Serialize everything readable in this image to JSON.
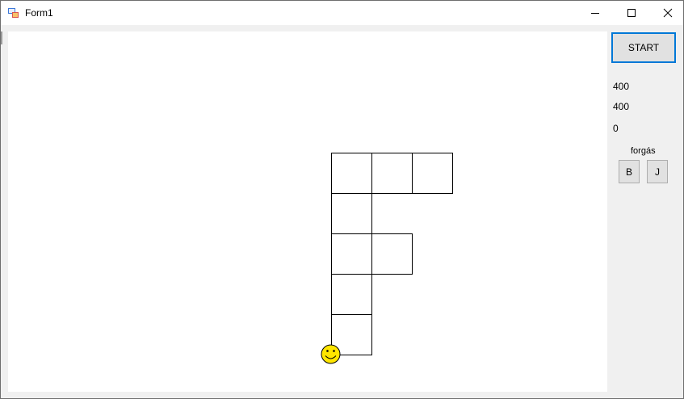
{
  "window": {
    "title": "Form1",
    "icon": "winforms-app-icon",
    "controls": [
      "minimize-icon",
      "maximize-icon",
      "close-icon"
    ]
  },
  "sidebar": {
    "start_label": "START",
    "value_x": "400",
    "value_y": "400",
    "value_angle": "0",
    "rotation_label": "forgás",
    "left_button": "B",
    "right_button": "J"
  },
  "drawing": {
    "turtle_icon": "smiley-face-icon",
    "turtle_color": "#ffe600",
    "line_color": "#000000"
  }
}
